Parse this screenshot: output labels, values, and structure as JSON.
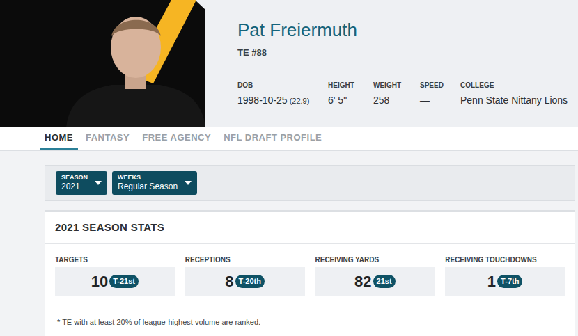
{
  "player": {
    "name": "Pat Freiermuth",
    "position": "TE #88"
  },
  "bio": [
    {
      "label": "DOB",
      "value": "1998-10-25",
      "note": "(22.9)"
    },
    {
      "label": "HEIGHT",
      "value": "6' 5\"",
      "note": ""
    },
    {
      "label": "WEIGHT",
      "value": "258",
      "note": ""
    },
    {
      "label": "SPEED",
      "value": "—",
      "note": ""
    },
    {
      "label": "COLLEGE",
      "value": "Penn State Nittany Lions",
      "note": ""
    }
  ],
  "tabs": [
    {
      "label": "HOME",
      "selected": true
    },
    {
      "label": "FANTASY",
      "selected": false
    },
    {
      "label": "FREE AGENCY",
      "selected": false
    },
    {
      "label": "NFL DRAFT PROFILE",
      "selected": false
    }
  ],
  "filters": [
    {
      "label": "SEASON",
      "value": "2021"
    },
    {
      "label": "WEEKS",
      "value": "Regular Season"
    }
  ],
  "stats": {
    "title": "2021 SEASON STATS",
    "items": [
      {
        "label": "TARGETS",
        "value": "10",
        "rank": "T-21st"
      },
      {
        "label": "RECEPTIONS",
        "value": "8",
        "rank": "T-20th"
      },
      {
        "label": "RECEIVING YARDS",
        "value": "82",
        "rank": "21st"
      },
      {
        "label": "RECEIVING TOUCHDOWNS",
        "value": "1",
        "rank": "T-7th"
      }
    ],
    "footnote": "* TE with at least 20% of league-highest volume are ranked."
  }
}
